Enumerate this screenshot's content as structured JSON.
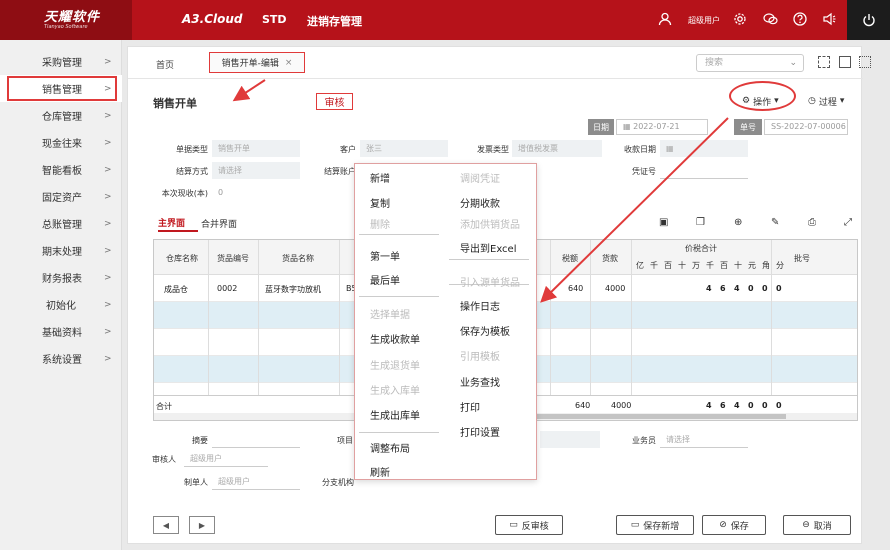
{
  "brand": {
    "logo_title": "天耀软件",
    "logo_sub": "Tianyao Software",
    "product": "A3.Cloud",
    "edition": "STD",
    "system_name": "进销存管理"
  },
  "topbar": {
    "user": "超级用户"
  },
  "sidebar": {
    "items": [
      {
        "label": "采购管理"
      },
      {
        "label": "销售管理"
      },
      {
        "label": "仓库管理"
      },
      {
        "label": "现金往来"
      },
      {
        "label": "智能看板"
      },
      {
        "label": "固定资产"
      },
      {
        "label": "总账管理"
      },
      {
        "label": "期末处理"
      },
      {
        "label": "财务报表"
      },
      {
        "label": "初始化"
      },
      {
        "label": "基础资料"
      },
      {
        "label": "系统设置"
      }
    ]
  },
  "tabs": {
    "home": "首页",
    "active": "销售开单-编辑"
  },
  "search": {
    "placeholder": "搜索"
  },
  "form": {
    "title": "销售开单",
    "status_badge": "审核",
    "ops_label": "操作",
    "process_label": "过程",
    "date_tag": "日期",
    "date_value": "2022-07-21",
    "no_tag": "单号",
    "no_value": "SS-2022-07-00006",
    "fields": {
      "doc_type_label": "单据类型",
      "doc_type_value": "销售开单",
      "customer_label": "客户",
      "customer_value": "张三",
      "invoice_type_label": "发票类型",
      "invoice_type_value": "增值税发票",
      "collect_date_label": "收款日期",
      "settle_label": "结算方式",
      "settle_placeholder": "请选择",
      "settle_account_label": "结算账户",
      "voucher_label": "凭证号",
      "current_collect_label": "本次现收(本)",
      "current_collect_value": "0"
    },
    "subtabs": {
      "main": "主界面",
      "merge": "合并界面"
    }
  },
  "grid": {
    "headers": {
      "warehouse": "仓库名称",
      "item_code": "货品编号",
      "item_name": "货品名称",
      "tax": "税额",
      "amount": "货款",
      "tax_total": "价税合计",
      "batch": "批号"
    },
    "digits": [
      "亿",
      "千",
      "百",
      "十",
      "万",
      "千",
      "百",
      "十",
      "元",
      "角",
      "分"
    ],
    "row": {
      "warehouse": "成品仓",
      "item_code": "0002",
      "item_name": "蓝牙数字功放机",
      "partial": "B5",
      "tax": "640",
      "amount": "4000",
      "digits": [
        "",
        "",
        "",
        "",
        "",
        "4",
        "6",
        "4",
        "0",
        "0",
        "0"
      ]
    },
    "total": {
      "label": "合计",
      "tax": "640",
      "amount": "4000",
      "digits": [
        "",
        "",
        "",
        "",
        "",
        "4",
        "6",
        "4",
        "0",
        "0",
        "0"
      ]
    }
  },
  "menu": {
    "left": [
      {
        "label": "新增",
        "enabled": true
      },
      {
        "label": "复制",
        "enabled": true
      },
      {
        "label": "删除",
        "enabled": false
      },
      {
        "label": "第一单",
        "enabled": true
      },
      {
        "label": "最后单",
        "enabled": true
      },
      {
        "label": "选择单据",
        "enabled": false
      },
      {
        "label": "生成收款单",
        "enabled": true
      },
      {
        "label": "生成退货单",
        "enabled": false
      },
      {
        "label": "生成入库单",
        "enabled": false
      },
      {
        "label": "生成出库单",
        "enabled": true
      },
      {
        "label": "调整布局",
        "enabled": true
      },
      {
        "label": "刷新",
        "enabled": true
      }
    ],
    "right": [
      {
        "label": "调阅凭证",
        "enabled": false
      },
      {
        "label": "分期收款",
        "enabled": true
      },
      {
        "label": "添加供销货品",
        "enabled": false
      },
      {
        "label": "导出到Excel",
        "enabled": true
      },
      {
        "label": "引入源单货品",
        "enabled": false
      },
      {
        "label": "操作日志",
        "enabled": true
      },
      {
        "label": "保存为模板",
        "enabled": true
      },
      {
        "label": "引用模板",
        "enabled": false
      },
      {
        "label": "业务查找",
        "enabled": true
      },
      {
        "label": "打印",
        "enabled": true
      },
      {
        "label": "打印设置",
        "enabled": true
      }
    ]
  },
  "bottom": {
    "summary_label": "摘要",
    "project_label": "项目",
    "salesman_label": "业务员",
    "salesman_placeholder": "请选择",
    "auditor_label": "审核人",
    "auditor_value": "超级用户",
    "maker_label": "制单人",
    "maker_value": "超级用户",
    "branch_label": "分支机构"
  },
  "buttons": {
    "unaudit": "反审核",
    "save_new": "保存新增",
    "save": "保存",
    "cancel": "取消"
  },
  "colors": {
    "brand_red": "#b6121a",
    "highlight_red": "#e03a3a"
  }
}
